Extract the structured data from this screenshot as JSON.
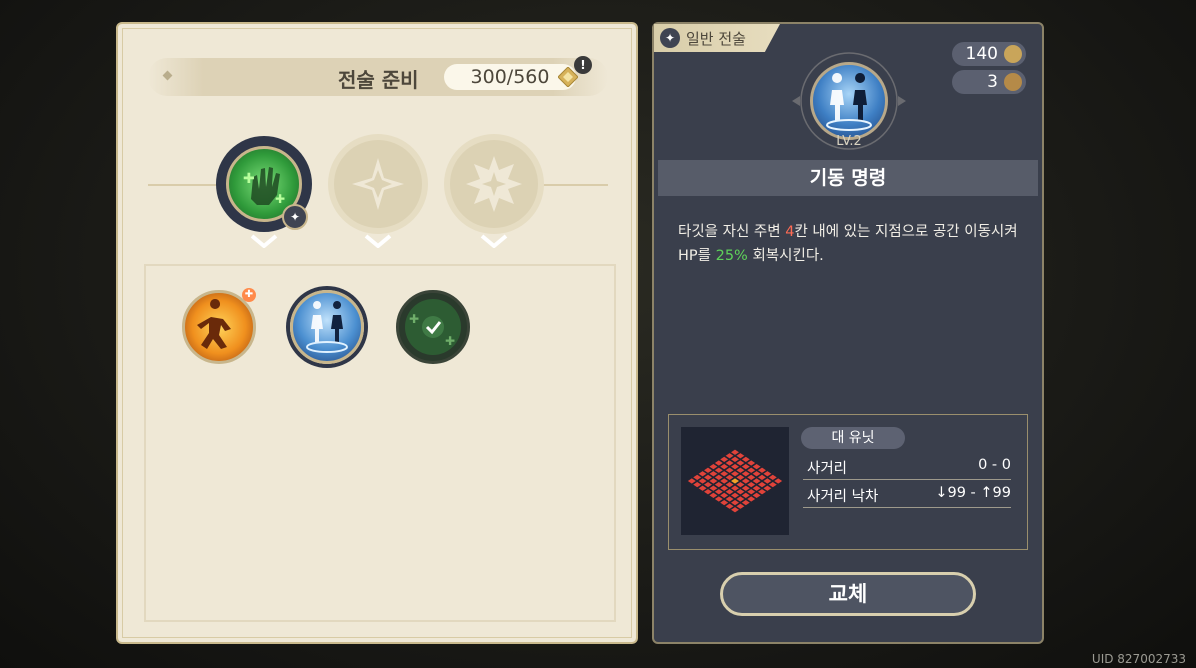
{
  "prep": {
    "title": "전술 준비",
    "count": "300/560",
    "alert": "!"
  },
  "tactic": {
    "category": "일반 전술",
    "cost_value": "140",
    "turn_value": "3",
    "level": "LV.2",
    "name": "기동 명령",
    "desc_part1": "타깃을 자신 주변 ",
    "desc_range": "4",
    "desc_part2": "칸 내에 있는 지점으로 공간 이동시켜 HP를 ",
    "desc_heal": "25%",
    "desc_part3": " 회복시킨다.",
    "target_type": "대 유닛",
    "range_label": "사거리",
    "range_value": "0 - 0",
    "elev_label": "사거리 낙차",
    "elev_value": "↓99 - ↑99",
    "replace_label": "교체"
  },
  "uid": "UID 827002733",
  "colors": {
    "panel_light": "#efe8d6",
    "panel_dark": "#3a3f4c",
    "highlight_red": "#ff6b54",
    "highlight_green": "#5fd25a"
  }
}
